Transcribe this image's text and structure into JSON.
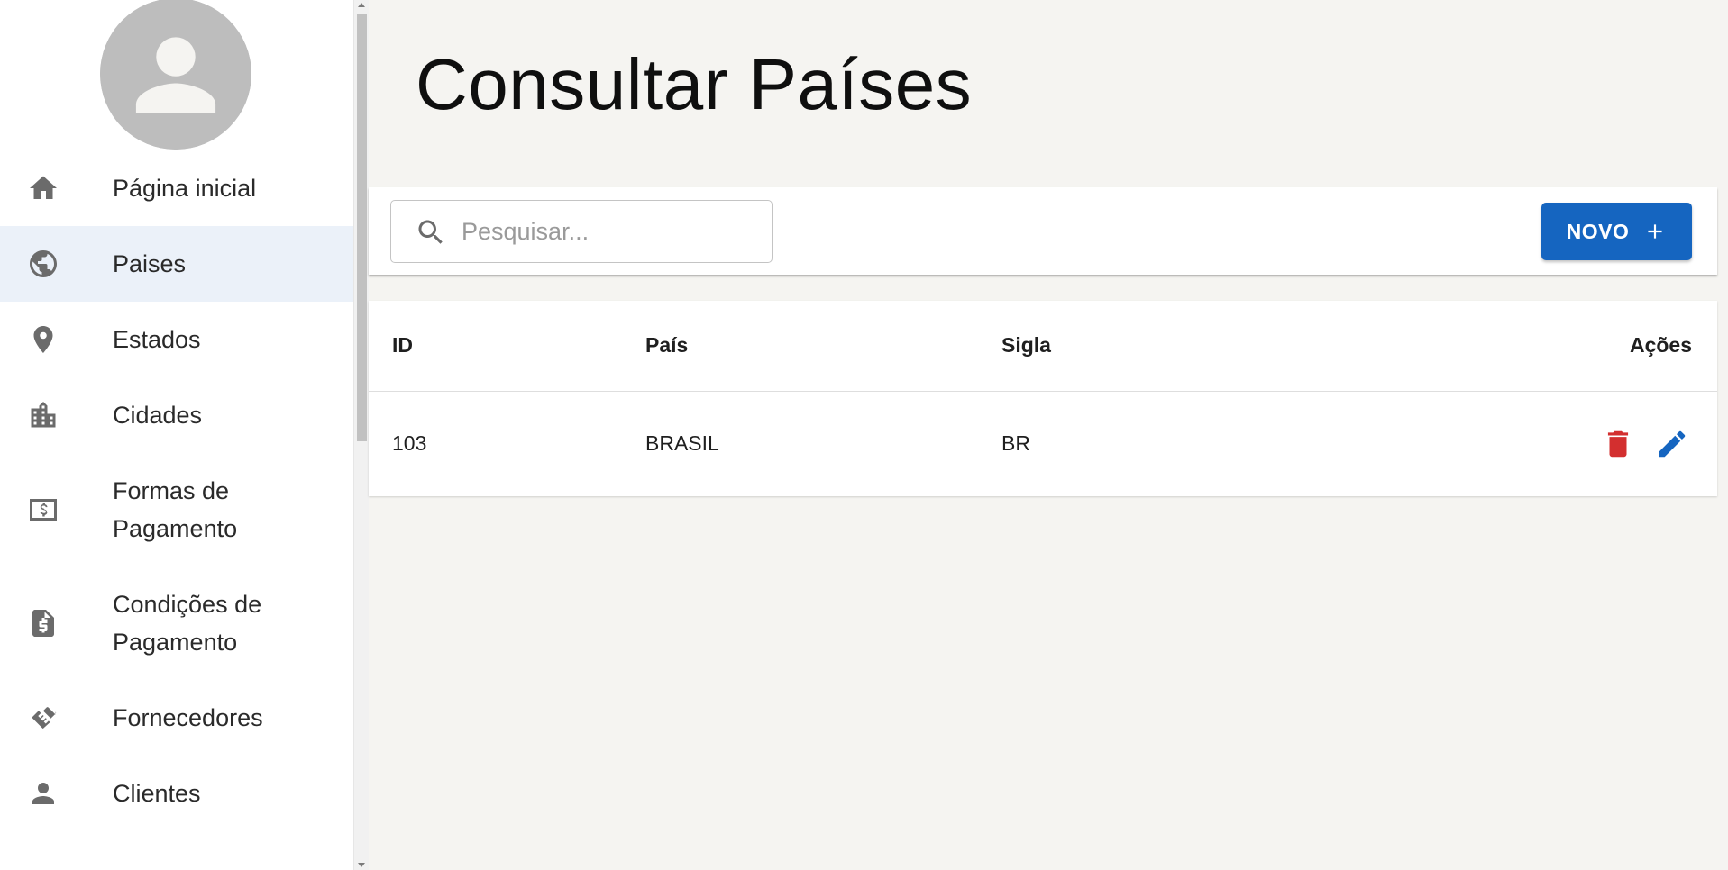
{
  "sidebar": {
    "avatar_icon": "person-icon",
    "items": [
      {
        "label": "Página inicial",
        "icon": "home-icon",
        "active": false
      },
      {
        "label": "Paises",
        "icon": "globe-icon",
        "active": true
      },
      {
        "label": "Estados",
        "icon": "location-pin-icon",
        "active": false
      },
      {
        "label": "Cidades",
        "icon": "city-icon",
        "active": false
      },
      {
        "label": "Formas de Pagamento",
        "icon": "money-icon",
        "active": false
      },
      {
        "label": "Condições de Pagamento",
        "icon": "invoice-dollar-icon",
        "active": false
      },
      {
        "label": "Fornecedores",
        "icon": "handshake-icon",
        "active": false
      },
      {
        "label": "Clientes",
        "icon": "person-icon",
        "active": false
      }
    ]
  },
  "page": {
    "title": "Consultar Países"
  },
  "toolbar": {
    "search_placeholder": "Pesquisar...",
    "search_value": "",
    "new_label": "NOVO"
  },
  "table": {
    "headers": {
      "id": "ID",
      "pais": "País",
      "sigla": "Sigla",
      "acoes": "Ações"
    },
    "rows": [
      {
        "id": "103",
        "pais": "BRASIL",
        "sigla": "BR"
      }
    ]
  },
  "colors": {
    "primary": "#1565c0",
    "delete": "#d32f2f",
    "edit": "#1565c0",
    "active_nav_bg": "#ebf1f9",
    "icon_gray": "#6b6b6b"
  }
}
